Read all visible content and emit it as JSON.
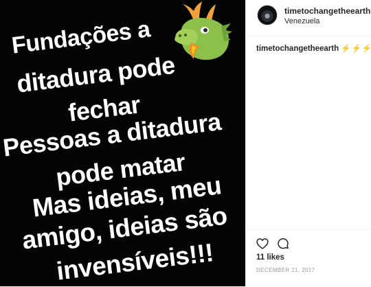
{
  "post": {
    "image_text_lines": [
      "Fundações a",
      "ditadura pode",
      "fechar",
      "Pessoas a ditadura",
      "pode matar",
      "Mas ideias, meu",
      "amigo, ideias são",
      "invensíveis!!!"
    ],
    "image_emoji": "dragon-face-icon"
  },
  "header": {
    "username": "timetochangetheearth",
    "location": "Venezuela"
  },
  "caption": {
    "username": "timetochangetheearth",
    "text": "⚡⚡⚡"
  },
  "actions": {
    "like_icon": "heart-icon",
    "comment_icon": "comment-icon"
  },
  "likes": "11 likes",
  "date": "DECEMBER 21, 2017",
  "colors": {
    "image_bg": "#050505",
    "text": "#262626",
    "muted": "#999999",
    "divider": "#efefef"
  }
}
